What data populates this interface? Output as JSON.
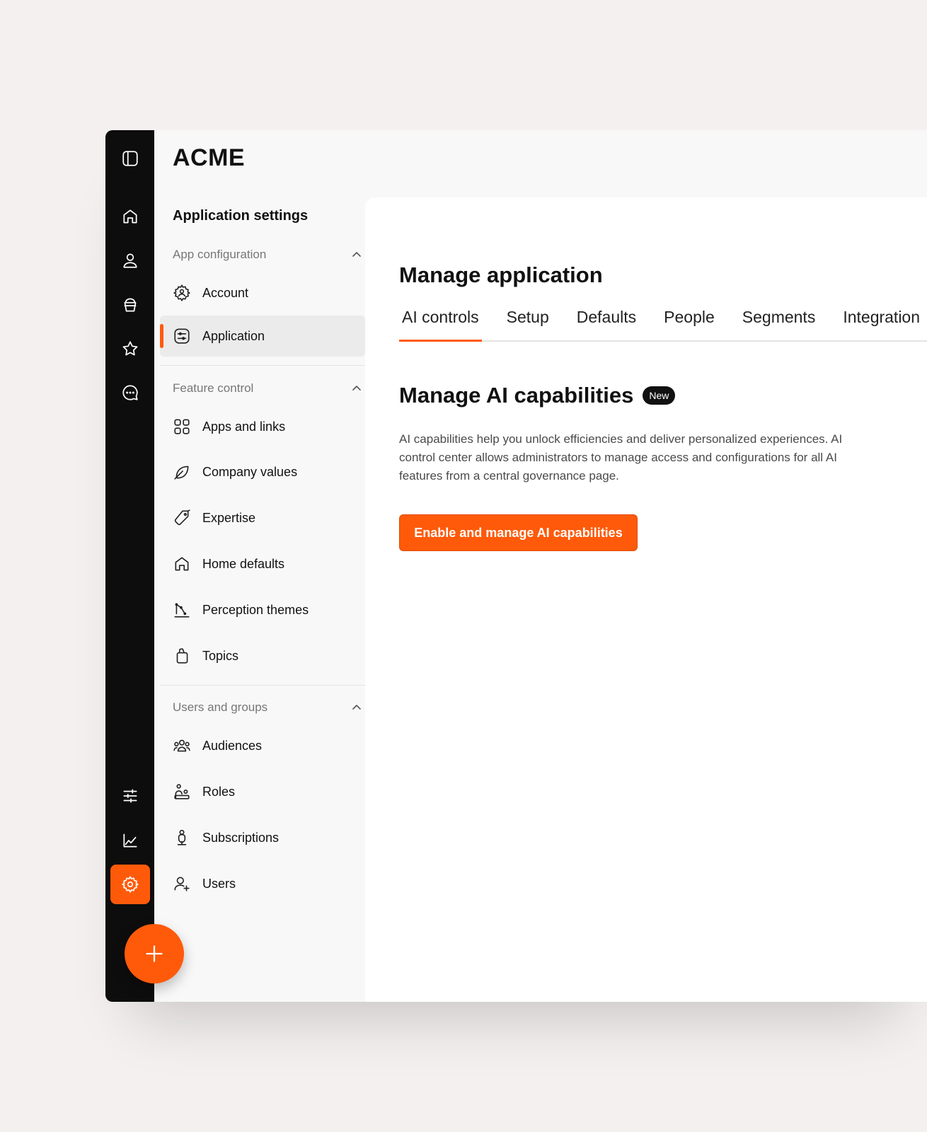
{
  "brand": "ACME",
  "nav": {
    "title": "Application settings",
    "sections": [
      {
        "label": "App configuration",
        "items": [
          {
            "label": "Account",
            "icon": "gear-user-icon"
          },
          {
            "label": "Application",
            "icon": "application-icon",
            "active": true
          }
        ]
      },
      {
        "label": "Feature control",
        "items": [
          {
            "label": "Apps and links",
            "icon": "grid-icon"
          },
          {
            "label": "Company values",
            "icon": "leaf-icon"
          },
          {
            "label": "Expertise",
            "icon": "tag-icon"
          },
          {
            "label": "Home defaults",
            "icon": "home-icon"
          },
          {
            "label": "Perception themes",
            "icon": "chart-theme-icon"
          },
          {
            "label": "Topics",
            "icon": "topics-icon"
          }
        ]
      },
      {
        "label": "Users and groups",
        "items": [
          {
            "label": "Audiences",
            "icon": "audiences-icon"
          },
          {
            "label": "Roles",
            "icon": "roles-icon"
          },
          {
            "label": "Subscriptions",
            "icon": "subscriptions-icon"
          },
          {
            "label": "Users",
            "icon": "user-add-icon"
          }
        ]
      }
    ]
  },
  "main": {
    "title": "Manage application",
    "tabs": [
      "AI controls",
      "Setup",
      "Defaults",
      "People",
      "Segments",
      "Integration"
    ],
    "active_tab": "AI controls",
    "section_title": "Manage AI capabilities",
    "badge": "New",
    "description": "AI capabilities help you unlock efficiencies and deliver personalized experiences. AI control center allows administrators to manage access and configurations for all AI features from a central governance page.",
    "cta_label": "Enable and manage AI capabilities"
  },
  "colors": {
    "accent": "#ff5a0a",
    "rail": "#0d0d0d"
  }
}
